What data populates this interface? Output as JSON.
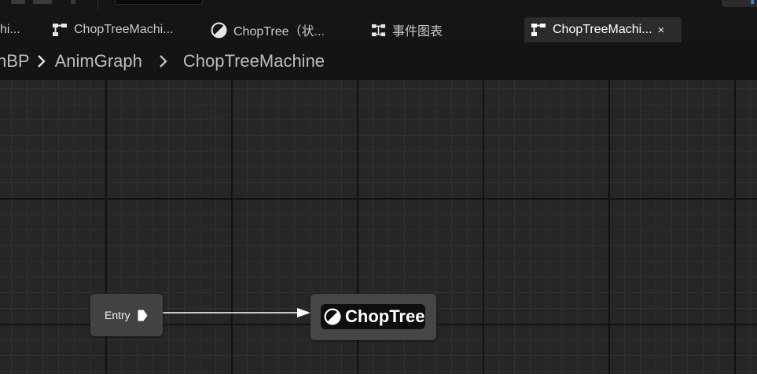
{
  "tabs": [
    {
      "label": "hi...",
      "icon": "none",
      "active": false
    },
    {
      "label": "ChopTreeMachi...",
      "icon": "state-machine-icon",
      "active": false
    },
    {
      "label": "ChopTree（状...",
      "icon": "state-icon",
      "active": false
    },
    {
      "label": "事件图表",
      "icon": "event-graph-icon",
      "active": false
    },
    {
      "label": "ChopTreeMachi...",
      "icon": "state-machine-icon",
      "active": true
    }
  ],
  "active_tab_close": "×",
  "breadcrumb": [
    "nBP",
    "AnimGraph",
    "ChopTreeMachine"
  ],
  "graph": {
    "entry_node": {
      "label": "Entry",
      "icon": "entry-pin-icon"
    },
    "state_node": {
      "label": "ChopTree",
      "icon": "state-icon"
    },
    "transition": {
      "from": "Entry",
      "to": "ChopTree",
      "icon": "arrow-head-icon"
    }
  },
  "colors": {
    "background": "#232323",
    "tab_bar": "#151515",
    "active_tab": "#2b2b2b",
    "node": "#434343",
    "state_inner": "#0e0e0e",
    "wire": "#ffffff",
    "accent": "#4a7fc0"
  }
}
